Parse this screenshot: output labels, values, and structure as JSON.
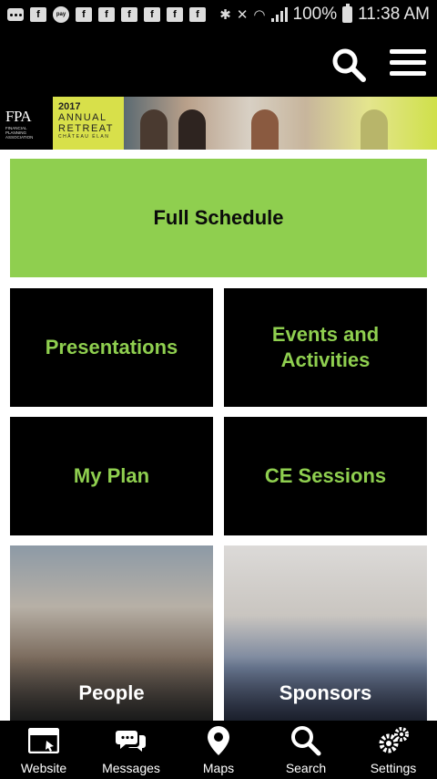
{
  "status_bar": {
    "battery": "100%",
    "time": "11:38 AM",
    "pay_label": "pay"
  },
  "header": {
    "search_icon": "search-icon",
    "menu_icon": "hamburger-menu-icon"
  },
  "banner": {
    "logo_text": "FPA",
    "logo_sub": [
      "Financial",
      "Planning",
      "Association"
    ],
    "year": "2017",
    "line1": "ANNUAL",
    "line2": "RETREAT",
    "line3": "CHÂTEAU ÉLAN"
  },
  "tiles": {
    "full_schedule": "Full Schedule",
    "presentations": "Presentations",
    "events_line1": "Events and",
    "events_line2": "Activities",
    "my_plan": "My Plan",
    "ce_sessions": "CE Sessions",
    "people": "People",
    "sponsors": "Sponsors"
  },
  "nav": [
    {
      "label": "Website",
      "icon": "browser-window-icon"
    },
    {
      "label": "Messages",
      "icon": "chat-bubbles-icon"
    },
    {
      "label": "Maps",
      "icon": "map-pin-icon"
    },
    {
      "label": "Search",
      "icon": "search-icon"
    },
    {
      "label": "Settings",
      "icon": "gears-icon"
    }
  ],
  "colors": {
    "accent_green": "#8fcf4f",
    "background": "#000000",
    "content_bg": "#ffffff"
  }
}
